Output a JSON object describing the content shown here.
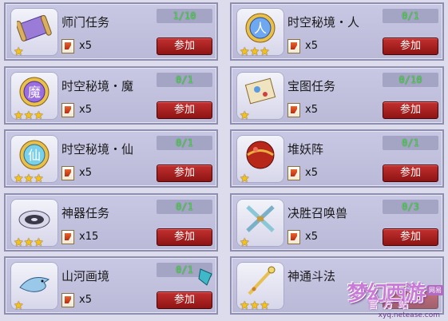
{
  "tasks": [
    {
      "title": "师门任务",
      "progress": "1/10",
      "reward_count": "x5",
      "stars": "★",
      "join_label": "参加",
      "icon": "scroll-icon"
    },
    {
      "title": "时空秘境・人",
      "progress": "0/1",
      "reward_count": "x5",
      "stars": "★★★",
      "join_label": "参加",
      "icon": "realm-orb-icon"
    },
    {
      "title": "时空秘境・魔",
      "progress": "0/1",
      "reward_count": "x5",
      "stars": "★★★",
      "join_label": "参加",
      "icon": "realm-orb-icon"
    },
    {
      "title": "宝图任务",
      "progress": "0/10",
      "reward_count": "x5",
      "stars": "★",
      "join_label": "参加",
      "icon": "treasure-map-icon"
    },
    {
      "title": "时空秘境・仙",
      "progress": "0/1",
      "reward_count": "x5",
      "stars": "★★★",
      "join_label": "参加",
      "icon": "realm-orb-icon"
    },
    {
      "title": "堆妖阵",
      "progress": "0/1",
      "reward_count": "x5",
      "stars": "★",
      "join_label": "参加",
      "icon": "demon-ball-icon"
    },
    {
      "title": "神器任务",
      "progress": "0/1",
      "reward_count": "x15",
      "stars": "★★★",
      "join_label": "参加",
      "icon": "artifact-disc-icon"
    },
    {
      "title": "决胜召唤兽",
      "progress": "0/3",
      "reward_count": "x5",
      "stars": "★",
      "join_label": "参加",
      "icon": "crossed-swords-icon"
    },
    {
      "title": "山河画境",
      "progress": "0/1",
      "reward_count": "x5",
      "stars": "★",
      "join_label": "参加",
      "icon": "shark-icon"
    },
    {
      "title": "神通斗法",
      "progress": "",
      "reward_count": "",
      "stars": "★★★",
      "join_label": "参加",
      "icon": "golden-staff-icon"
    }
  ],
  "watermark": {
    "logo": "梦幻西游",
    "sub": "官方站",
    "tag": "网易",
    "url": "xyq.netease.com"
  },
  "colors": {
    "progress_text": "#46d846",
    "button": "#a01e1e",
    "star": "#f5c21a",
    "card_bg": "#c0c0de"
  }
}
